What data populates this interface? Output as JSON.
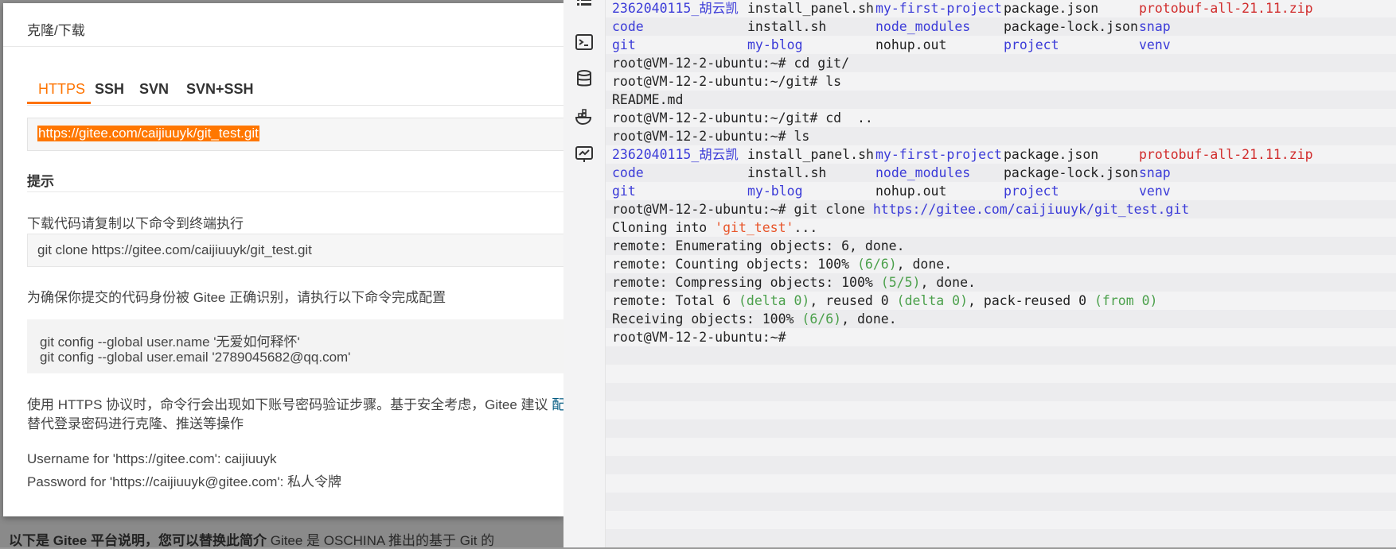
{
  "dialog": {
    "title": "克隆/下载",
    "tabs": [
      "HTTPS",
      "SSH",
      "SVN",
      "SVN+SSH"
    ],
    "active_tab": "HTTPS",
    "clone_url": "https://gitee.com/caijiuuyk/git_test.git",
    "hint_title": "提示",
    "download_label": "下载代码请复制以下命令到终端执行",
    "clone_command": "git clone https://gitee.com/caijiuuyk/git_test.git",
    "config_label": "为确保你提交的代码身份被 Gitee 正确识别，请执行以下命令完成配置",
    "config_lines": [
      "git config --global user.name '无爱如何释怀'",
      "git config --global user.email '2789045682@qq.com'"
    ],
    "https_note_a": "使用 HTTPS 协议时，命令行会出现如下账号密码验证步骤。基于安全考虑，Gitee 建议 ",
    "https_note_link": "配",
    "https_note_b": "替代登录密码进行克隆、推送等操作",
    "username_line": "Username for 'https://gitee.com': caijiuuyk",
    "password_line": "Password for 'https://caijiuuyk@gitee.com': 私人令牌",
    "accent": "#fe7300"
  },
  "page_behind": {
    "bottom_text_bold": "以下是 Gitee 平台说明，您可以替换此简介",
    "bottom_text_rest": " Gitee 是 OSCHINA 推出的基于 Git 的"
  },
  "terminal_sidebar": {
    "icons": [
      "list-icon",
      "terminal-icon",
      "database-icon",
      "docker-icon",
      "monitor-icon"
    ]
  },
  "terminal": {
    "ls_rows": [
      [
        "2362040115_胡云凯",
        "install_panel.sh",
        "my-first-project",
        "package.json",
        "protobuf-all-21.11.zip"
      ],
      [
        "code",
        "install.sh",
        "node_modules",
        "package-lock.json",
        "snap"
      ],
      [
        "git",
        "my-blog",
        "nohup.out",
        "project",
        "venv"
      ]
    ],
    "prompt_home": "root@VM-12-2-ubuntu:~#",
    "prompt_git": "root@VM-12-2-ubuntu:~/git#",
    "cmd_cd_git": " cd git/",
    "cmd_ls": " ls",
    "readme": "README.md",
    "cmd_cd_up": " cd  ..",
    "cmd_clone_pre": " git clone ",
    "cmd_clone_url": "https://gitee.com/caijiuuyk/git_test.git",
    "cloning_pre": "Cloning into ",
    "cloning_name": "'git_test'",
    "cloning_post": "...",
    "enum_line": "remote: Enumerating objects: 6, done.",
    "count_pre": "remote: Counting objects: 100% ",
    "count_paren": "(6/6)",
    "count_post": ", done.",
    "compress_pre": "remote: Compressing objects: 100% ",
    "compress_paren": "(5/5)",
    "compress_post": ", done.",
    "total_a": "remote: Total 6 ",
    "total_b": "(delta 0)",
    "total_c": ", reused 0 ",
    "total_d": "(delta 0)",
    "total_e": ", pack-reused 0 ",
    "total_f": "(from 0)",
    "recv_pre": "Receiving objects: 100% ",
    "recv_paren": "(6/6)",
    "recv_post": ", done."
  }
}
